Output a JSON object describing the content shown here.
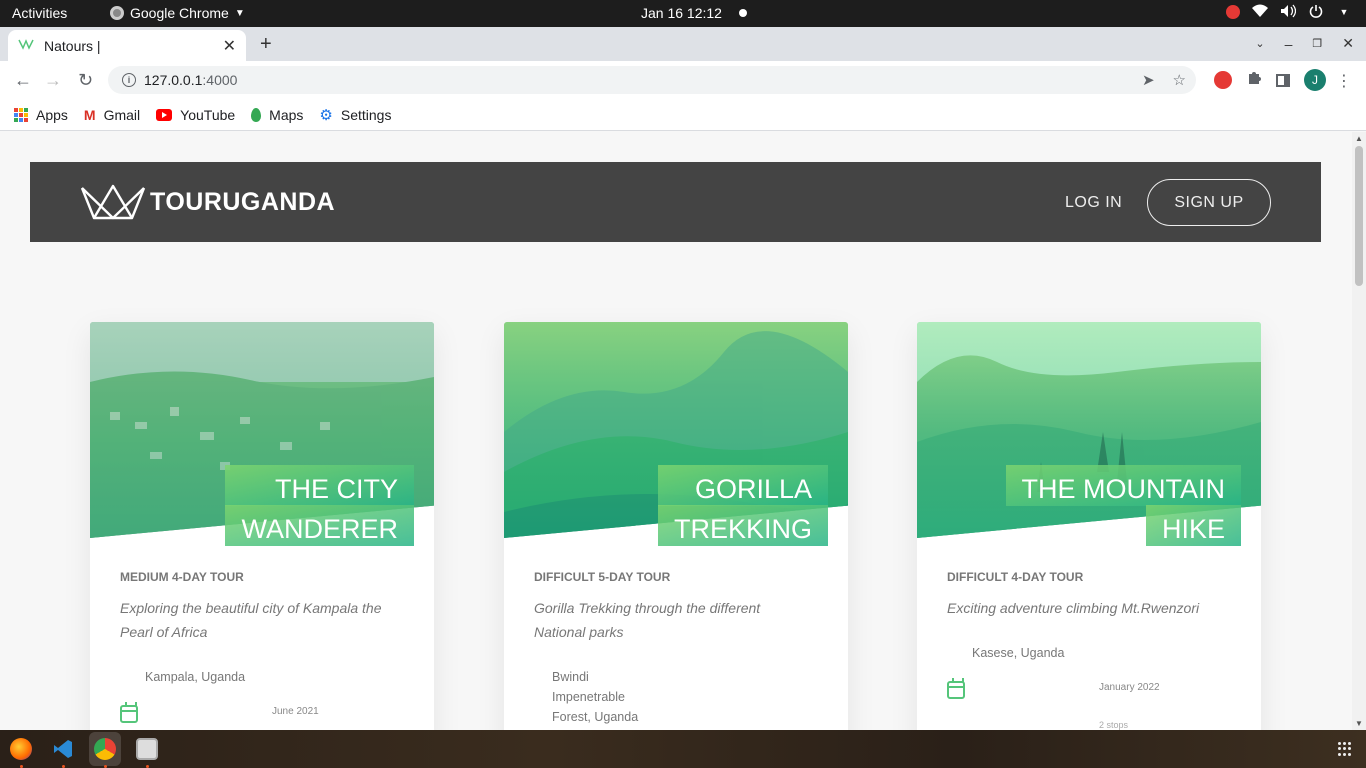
{
  "system": {
    "activities": "Activities",
    "app_name": "Google Chrome",
    "clock": "Jan 16  12:12"
  },
  "browser": {
    "tab_title": "Natours |",
    "url_host": "127.0.0.1",
    "url_port": ":4000",
    "profile_initial": "J",
    "bookmarks": [
      {
        "label": "Apps",
        "icon": "apps-grid-icon"
      },
      {
        "label": "Gmail",
        "icon": "gmail-icon"
      },
      {
        "label": "YouTube",
        "icon": "youtube-icon"
      },
      {
        "label": "Maps",
        "icon": "maps-pin-icon"
      },
      {
        "label": "Settings",
        "icon": "settings-gear-icon"
      }
    ]
  },
  "site": {
    "brand": "TOURUGANDA",
    "nav": {
      "login": "LOG IN",
      "signup": "SIGN UP"
    },
    "accent_color": "#55c57a",
    "header_color": "#444444",
    "tours": [
      {
        "title_line1": "THE CITY",
        "title_line2": "WANDERER",
        "subheading": "MEDIUM 4-DAY TOUR",
        "summary": "Exploring the beautiful city of Kampala the Pearl of Africa",
        "location": "Kampala, Uganda",
        "date": "June 2021",
        "stops": ""
      },
      {
        "title_line1": "GORILLA",
        "title_line2": "TREKKING",
        "subheading": "DIFFICULT 5-DAY TOUR",
        "summary": "Gorilla Trekking through the different National parks",
        "location_lines": [
          "Bwindi",
          "Impenetrable",
          "Forest, Uganda"
        ],
        "date": "",
        "stops": ""
      },
      {
        "title_line1": "THE MOUNTAIN",
        "title_line2": "HIKE",
        "subheading": "DIFFICULT 4-DAY TOUR",
        "summary": "Exciting adventure climbing Mt.Rwenzori",
        "location": "Kasese, Uganda",
        "date": "January 2022",
        "stops": "2 stops"
      }
    ]
  }
}
